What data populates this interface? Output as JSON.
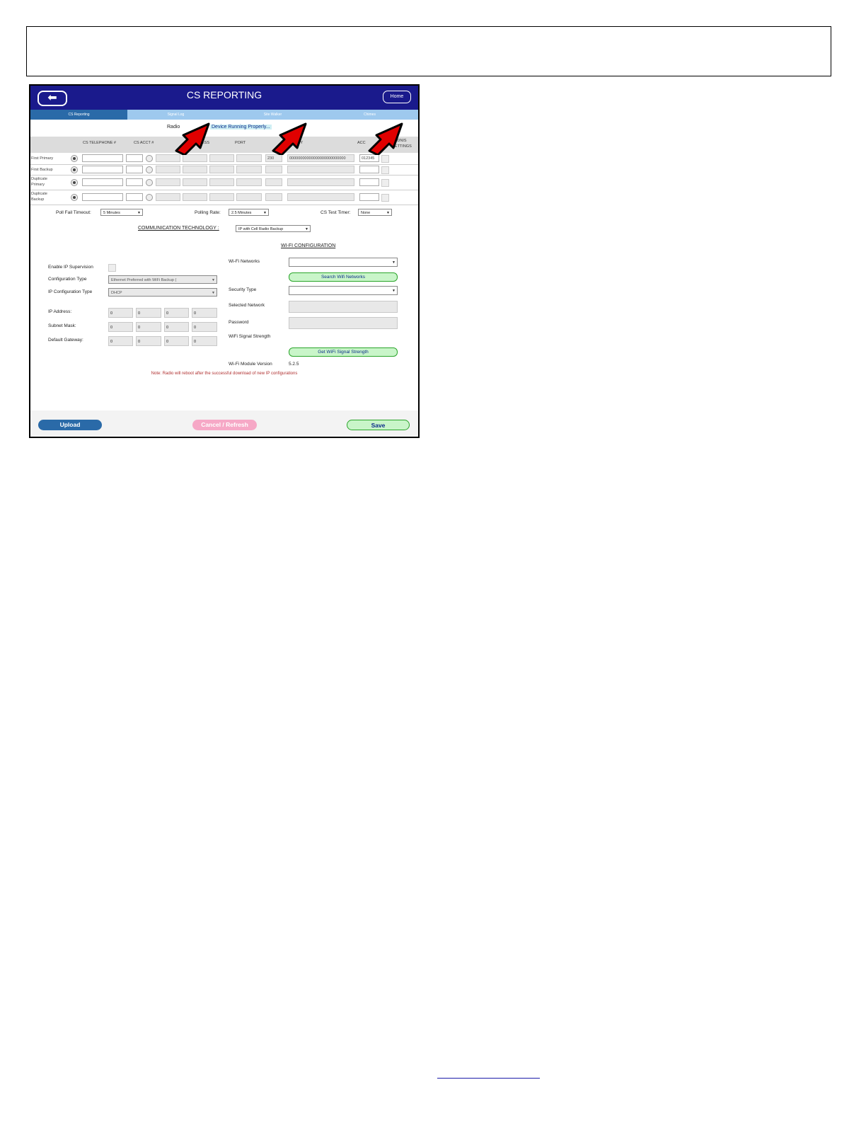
{
  "header": {
    "title": "CS REPORTING",
    "back_icon": "arrow-left-icon",
    "home_label": "Home"
  },
  "tabs": [
    {
      "label": "CS Reporting",
      "active": true
    },
    {
      "label": "Signal Log",
      "active": false
    },
    {
      "label": "Site Walker",
      "active": false
    },
    {
      "label": "Chimes",
      "active": false
    }
  ],
  "status": {
    "label": "Radio",
    "badge": "Device Running Properly..."
  },
  "columns": {
    "telephone": "CS TELEPHONE #",
    "acct": "CS ACCT #",
    "ip_address": "ESS",
    "port": "PORT",
    "key": "KEY",
    "account": "ACC",
    "dnis": "DNIS SETTINGS"
  },
  "rows": [
    {
      "label": "First Primary",
      "port": "230",
      "key": "00000000000000000000000000",
      "account": "012345"
    },
    {
      "label": "First Backup",
      "port": "",
      "key": "",
      "account": ""
    },
    {
      "label": "Duplicate Primary",
      "port": "",
      "key": "",
      "account": ""
    },
    {
      "label": "Duplicate Backup",
      "port": "",
      "key": "",
      "account": ""
    }
  ],
  "timers": {
    "poll_fail_label": "Poll Fail Timeout:",
    "poll_fail_value": "5 Minutes",
    "polling_rate_label": "Polling Rate:",
    "polling_rate_value": "2.5 Minutes",
    "test_timer_label": "CS Test Timer:",
    "test_timer_value": "None"
  },
  "comm_tech": {
    "label": "COMMUNICATION TECHNOLOGY :",
    "value": "IP with Cell Radio Backup"
  },
  "ip": {
    "enable_label": "Enable IP Supervision",
    "config_type_label": "Configuration Type",
    "config_type_value": "Ethernet Preferred with WiFi Backup (",
    "ip_config_label": "IP Configuration Type",
    "ip_config_value": "DHCP",
    "ip_address_label": "IP Address:",
    "subnet_label": "Subnet Mask:",
    "gateway_label": "Default Gateway:",
    "octet_value": "0"
  },
  "wifi": {
    "heading": "WI-FI CONFIGURATION",
    "networks_label": "Wi-Fi Networks",
    "search_button": "Search Wifi Networks",
    "security_label": "Security Type",
    "selected_label": "Selected Network",
    "password_label": "Password",
    "strength_label": "WiFi Signal Strength",
    "strength_button": "Get WiFi Signal Strength",
    "module_label": "Wi-Fi Module Version",
    "module_value": "5.2.5"
  },
  "note": "Note: Radio will reboot after the successful download of new IP configurations",
  "footer": {
    "upload": "Upload",
    "cancel": "Cancel / Refresh",
    "save": "Save"
  },
  "colors": {
    "header": "#1a1a8c",
    "tab_active": "#2a6aa8",
    "tab_bar": "#9ec9ee",
    "arrow": "#e00000"
  }
}
